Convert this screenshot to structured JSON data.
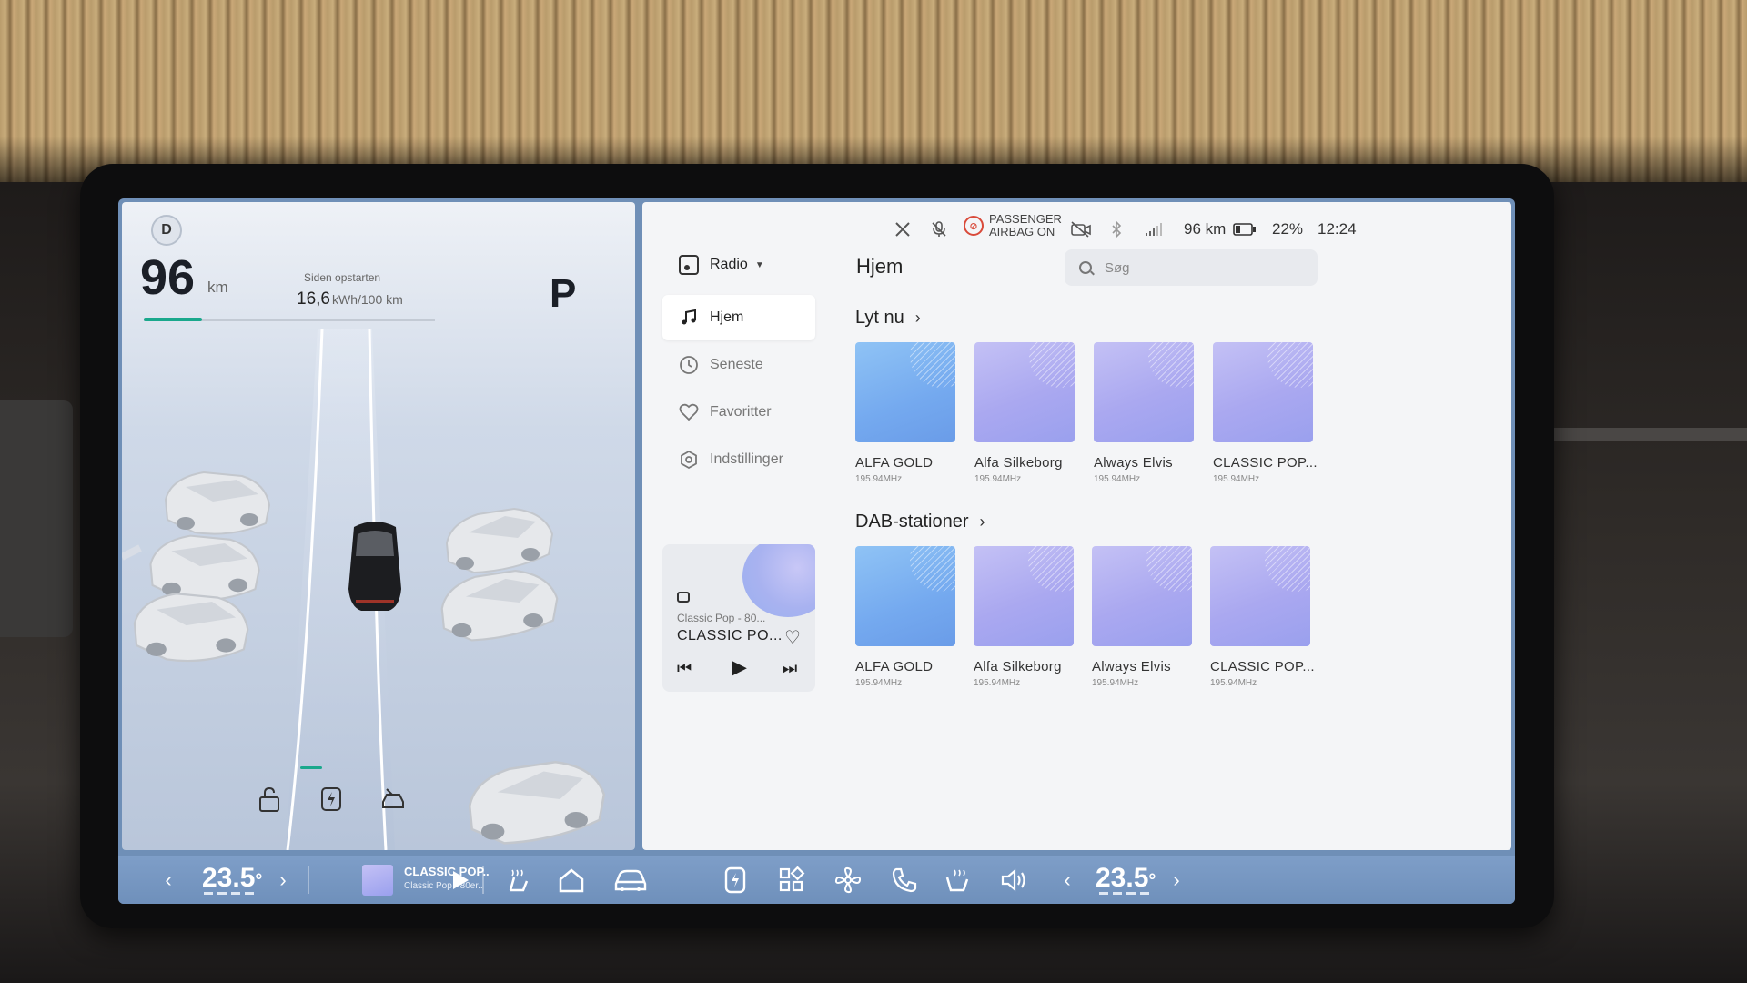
{
  "left_panel": {
    "range_value": "96",
    "range_unit": "km",
    "since_label": "Siden opstarten",
    "consumption_value": "16,6",
    "consumption_unit": "kWh/100 km",
    "gear": "P",
    "range_progress_fraction": 0.2
  },
  "status_bar": {
    "airbag_line1": "PASSENGER",
    "airbag_line2": "AIRBAG ON",
    "range": "96 km",
    "battery": "22%",
    "time": "12:24"
  },
  "radio": {
    "source_label": "Radio",
    "page_title": "Hjem",
    "search_placeholder": "Søg",
    "nav": [
      {
        "label": "Hjem",
        "icon": "music-note-icon"
      },
      {
        "label": "Seneste",
        "icon": "clock-icon"
      },
      {
        "label": "Favoritter",
        "icon": "heart-icon"
      },
      {
        "label": "Indstillinger",
        "icon": "settings-icon"
      }
    ],
    "mini_player": {
      "subtitle": "Classic Pop - 80...",
      "title": "CLASSIC PO..."
    },
    "sections": [
      {
        "title": "Lyt nu",
        "tiles": [
          {
            "name": "ALFA GOLD",
            "freq": "195.94MHz",
            "color": "blue"
          },
          {
            "name": "Alfa Silkeborg",
            "freq": "195.94MHz",
            "color": "purple"
          },
          {
            "name": "Always Elvis",
            "freq": "195.94MHz",
            "color": "purple"
          },
          {
            "name": "CLASSIC POP...",
            "freq": "195.94MHz",
            "color": "purple"
          }
        ]
      },
      {
        "title": "DAB-stationer",
        "tiles": [
          {
            "name": "ALFA GOLD",
            "freq": "195.94MHz",
            "color": "blue"
          },
          {
            "name": "Alfa Silkeborg",
            "freq": "195.94MHz",
            "color": "purple"
          },
          {
            "name": "Always Elvis",
            "freq": "195.94MHz",
            "color": "purple"
          },
          {
            "name": "CLASSIC POP...",
            "freq": "195.94MHz",
            "color": "purple"
          }
        ]
      }
    ]
  },
  "bottom_bar": {
    "temp_left": "23.5",
    "temp_right": "23.5",
    "temp_unit": "°",
    "now_playing_title": "CLASSIC POP..",
    "now_playing_sub": "Classic Pop - 80er.."
  },
  "colors": {
    "accent": "#1aa88c",
    "bottom_bar": "#7391bc",
    "airbag_red": "#d94a3a"
  }
}
